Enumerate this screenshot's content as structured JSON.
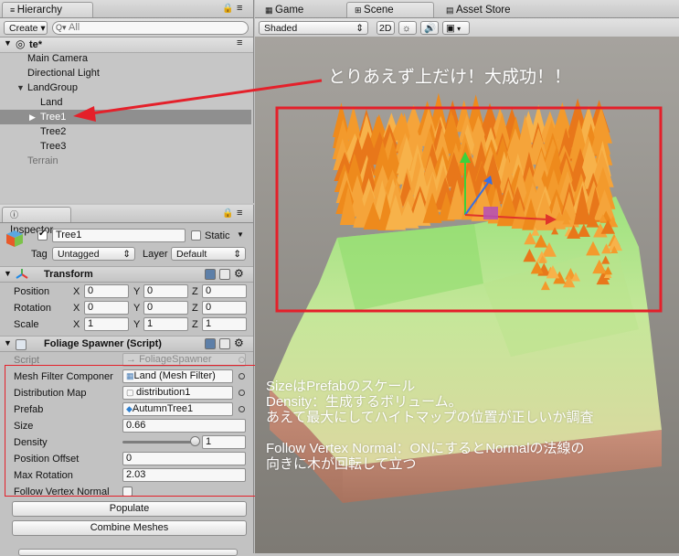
{
  "hierarchy": {
    "tab_label": "Hierarchy",
    "create_label": "Create ▾",
    "search_placeholder": "All",
    "scene_name": "te*",
    "items": [
      {
        "label": "Main Camera",
        "indent": 1,
        "dim": false,
        "selected": false,
        "expandable": false,
        "expanded": false
      },
      {
        "label": "Directional Light",
        "indent": 1,
        "dim": false,
        "selected": false,
        "expandable": false,
        "expanded": false
      },
      {
        "label": "LandGroup",
        "indent": 1,
        "dim": false,
        "selected": false,
        "expandable": true,
        "expanded": true
      },
      {
        "label": "Land",
        "indent": 2,
        "dim": false,
        "selected": false,
        "expandable": false,
        "expanded": false
      },
      {
        "label": "Tree1",
        "indent": 2,
        "dim": false,
        "selected": true,
        "expandable": true,
        "expanded": false
      },
      {
        "label": "Tree2",
        "indent": 2,
        "dim": false,
        "selected": false,
        "expandable": false,
        "expanded": false
      },
      {
        "label": "Tree3",
        "indent": 2,
        "dim": false,
        "selected": false,
        "expandable": false,
        "expanded": false
      },
      {
        "label": "Terrain",
        "indent": 1,
        "dim": true,
        "selected": false,
        "expandable": false,
        "expanded": false
      }
    ]
  },
  "inspector": {
    "tab_label": "Inspector",
    "object_name": "Tree1",
    "static_label": "Static",
    "tag_label": "Tag",
    "tag_value": "Untagged",
    "layer_label": "Layer",
    "layer_value": "Default",
    "transform": {
      "title": "Transform",
      "rows": [
        {
          "label": "Position",
          "x": "0",
          "y": "0",
          "z": "0"
        },
        {
          "label": "Rotation",
          "x": "0",
          "y": "0",
          "z": "0"
        },
        {
          "label": "Scale",
          "x": "1",
          "y": "1",
          "z": "1"
        }
      ],
      "axis_x": "X",
      "axis_y": "Y",
      "axis_z": "Z"
    },
    "script": {
      "title": "Foliage Spawner (Script)",
      "script_label": "Script",
      "script_value": "FoliageSpawner",
      "mesh_filter_label": "Mesh Filter Componer",
      "mesh_filter_value": "Land (Mesh Filter)",
      "distribution_label": "Distribution Map",
      "distribution_value": "distribution1",
      "prefab_label": "Prefab",
      "prefab_value": "AutumnTree1",
      "size_label": "Size",
      "size_value": "0.66",
      "density_label": "Density",
      "density_value": "1",
      "density_slider_fraction": 1.0,
      "position_offset_label": "Position Offset",
      "position_offset_value": "0",
      "max_rotation_label": "Max Rotation",
      "max_rotation_value": "2.03",
      "follow_normal_label": "Follow Vertex Normal",
      "populate_label": "Populate",
      "combine_label": "Combine Meshes"
    }
  },
  "scene_view": {
    "tab_game": "Game",
    "tab_scene": "Scene",
    "tab_asset_store": "Asset Store",
    "shading_mode": "Shaded",
    "mode_2d": "2D",
    "annotation_top": "とりあえず上だけ！大成功！！",
    "annotation_lines": [
      "SizeはPrefabのスケール",
      "Density：生成するボリューム。",
      "あえて最大にしてハイトマップの位置が正しいか調査",
      "",
      "Follow Vertex Normal：ONにするとNormalの法線の",
      "向きに木が回転して立つ"
    ]
  },
  "colors": {
    "highlight_red": "#e4202a",
    "scene_background": "#8e8a82",
    "terrain_green": "#8ed96f",
    "foliage_orange": "#f08a1e",
    "selection_gray": "#8f8f8f"
  }
}
